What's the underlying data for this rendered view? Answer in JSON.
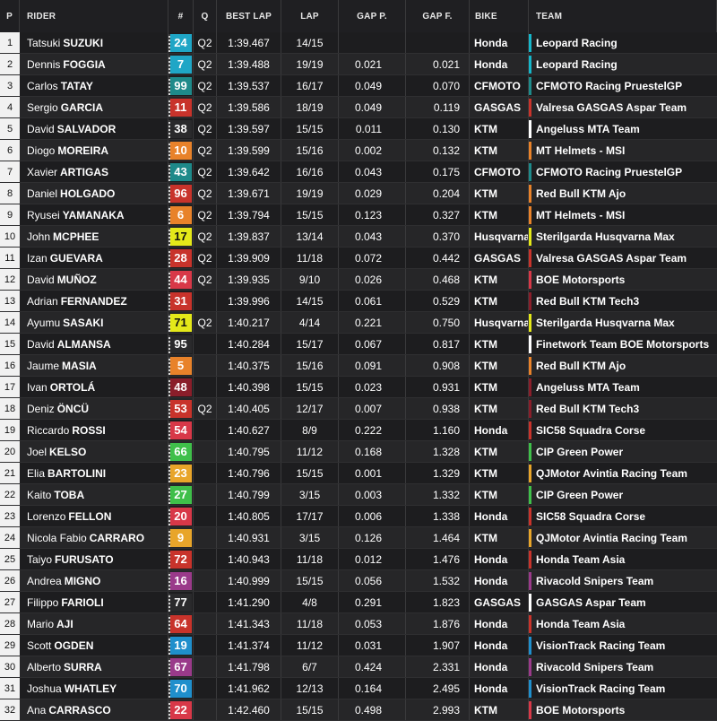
{
  "headers": {
    "pos": "P",
    "rider": "RIDER",
    "num": "#",
    "q": "Q",
    "best": "BEST LAP",
    "lap": "LAP",
    "gapp": "GAP P.",
    "gapf": "GAP F.",
    "bike": "BIKE",
    "team": "TEAM"
  },
  "rows": [
    {
      "pos": "1",
      "first": "Tatsuki",
      "last": "SUZUKI",
      "num": "24",
      "numColor": "#1fa6c6",
      "q": "Q2",
      "best": "1:39.467",
      "lap": "14/15",
      "gapp": "",
      "gapf": "",
      "bike": "Honda",
      "team": "Leopard Racing",
      "teamColor": "#16b6c9"
    },
    {
      "pos": "2",
      "first": "Dennis",
      "last": "FOGGIA",
      "num": "7",
      "numColor": "#1fa6c6",
      "q": "Q2",
      "best": "1:39.488",
      "lap": "19/19",
      "gapp": "0.021",
      "gapf": "0.021",
      "bike": "Honda",
      "team": "Leopard Racing",
      "teamColor": "#16b6c9"
    },
    {
      "pos": "3",
      "first": "Carlos",
      "last": "TATAY",
      "num": "99",
      "numColor": "#1e8a8a",
      "q": "Q2",
      "best": "1:39.537",
      "lap": "16/17",
      "gapp": "0.049",
      "gapf": "0.070",
      "bike": "CFMOTO",
      "team": "CFMOTO Racing PruestelGP",
      "teamColor": "#1e8a8a"
    },
    {
      "pos": "4",
      "first": "Sergio",
      "last": "GARCIA",
      "num": "11",
      "numColor": "#c8332b",
      "q": "Q2",
      "best": "1:39.586",
      "lap": "18/19",
      "gapp": "0.049",
      "gapf": "0.119",
      "bike": "GASGAS",
      "team": "Valresa GASGAS Aspar Team",
      "teamColor": "#c8332b"
    },
    {
      "pos": "5",
      "first": "David",
      "last": "SALVADOR",
      "num": "38",
      "numColor": "#2a2a2c",
      "q": "Q2",
      "best": "1:39.597",
      "lap": "15/15",
      "gapp": "0.011",
      "gapf": "0.130",
      "bike": "KTM",
      "team": "Angeluss MTA Team",
      "teamColor": "#ffffff"
    },
    {
      "pos": "6",
      "first": "Diogo",
      "last": "MOREIRA",
      "num": "10",
      "numColor": "#e8822a",
      "q": "Q2",
      "best": "1:39.599",
      "lap": "15/16",
      "gapp": "0.002",
      "gapf": "0.132",
      "bike": "KTM",
      "team": "MT Helmets - MSI",
      "teamColor": "#e8822a"
    },
    {
      "pos": "7",
      "first": "Xavier",
      "last": "ARTIGAS",
      "num": "43",
      "numColor": "#1e8a8a",
      "q": "Q2",
      "best": "1:39.642",
      "lap": "16/16",
      "gapp": "0.043",
      "gapf": "0.175",
      "bike": "CFMOTO",
      "team": "CFMOTO Racing PruestelGP",
      "teamColor": "#1e8a8a"
    },
    {
      "pos": "8",
      "first": "Daniel",
      "last": "HOLGADO",
      "num": "96",
      "numColor": "#c8332b",
      "q": "Q2",
      "best": "1:39.671",
      "lap": "19/19",
      "gapp": "0.029",
      "gapf": "0.204",
      "bike": "KTM",
      "team": "Red Bull KTM Ajo",
      "teamColor": "#e8822a"
    },
    {
      "pos": "9",
      "first": "Ryusei",
      "last": "YAMANAKA",
      "num": "6",
      "numColor": "#e8822a",
      "q": "Q2",
      "best": "1:39.794",
      "lap": "15/15",
      "gapp": "0.123",
      "gapf": "0.327",
      "bike": "KTM",
      "team": "MT Helmets - MSI",
      "teamColor": "#e8822a"
    },
    {
      "pos": "10",
      "first": "John",
      "last": "MCPHEE",
      "num": "17",
      "numColor": "#e4e819",
      "q": "Q2",
      "best": "1:39.837",
      "lap": "13/14",
      "gapp": "0.043",
      "gapf": "0.370",
      "bike": "Husqvarna",
      "team": "Sterilgarda Husqvarna Max",
      "teamColor": "#e4e819"
    },
    {
      "pos": "11",
      "first": "Izan",
      "last": "GUEVARA",
      "num": "28",
      "numColor": "#c8332b",
      "q": "Q2",
      "best": "1:39.909",
      "lap": "11/18",
      "gapp": "0.072",
      "gapf": "0.442",
      "bike": "GASGAS",
      "team": "Valresa GASGAS Aspar Team",
      "teamColor": "#c8332b"
    },
    {
      "pos": "12",
      "first": "David",
      "last": "MUÑOZ",
      "num": "44",
      "numColor": "#d83848",
      "q": "Q2",
      "best": "1:39.935",
      "lap": "9/10",
      "gapp": "0.026",
      "gapf": "0.468",
      "bike": "KTM",
      "team": "BOE Motorsports",
      "teamColor": "#d83848"
    },
    {
      "pos": "13",
      "first": "Adrian",
      "last": "FERNANDEZ",
      "num": "31",
      "numColor": "#c8332b",
      "q": "",
      "best": "1:39.996",
      "lap": "14/15",
      "gapp": "0.061",
      "gapf": "0.529",
      "bike": "KTM",
      "team": "Red Bull KTM Tech3",
      "teamColor": "#8a1e2a"
    },
    {
      "pos": "14",
      "first": "Ayumu",
      "last": "SASAKI",
      "num": "71",
      "numColor": "#e4e819",
      "q": "Q2",
      "best": "1:40.217",
      "lap": "4/14",
      "gapp": "0.221",
      "gapf": "0.750",
      "bike": "Husqvarna",
      "team": "Sterilgarda Husqvarna Max",
      "teamColor": "#e4e819"
    },
    {
      "pos": "15",
      "first": "David",
      "last": "ALMANSA",
      "num": "95",
      "numColor": "#2a2a2c",
      "q": "",
      "best": "1:40.284",
      "lap": "15/17",
      "gapp": "0.067",
      "gapf": "0.817",
      "bike": "KTM",
      "team": "Finetwork Team BOE Motorsports",
      "teamColor": "#ffffff"
    },
    {
      "pos": "16",
      "first": "Jaume",
      "last": "MASIA",
      "num": "5",
      "numColor": "#e8822a",
      "q": "",
      "best": "1:40.375",
      "lap": "15/16",
      "gapp": "0.091",
      "gapf": "0.908",
      "bike": "KTM",
      "team": "Red Bull KTM Ajo",
      "teamColor": "#e8822a"
    },
    {
      "pos": "17",
      "first": "Ivan",
      "last": "ORTOLÁ",
      "num": "48",
      "numColor": "#8a1e2a",
      "q": "",
      "best": "1:40.398",
      "lap": "15/15",
      "gapp": "0.023",
      "gapf": "0.931",
      "bike": "KTM",
      "team": "Angeluss MTA Team",
      "teamColor": "#8a1e2a"
    },
    {
      "pos": "18",
      "first": "Deniz",
      "last": "ÖNCÜ",
      "num": "53",
      "numColor": "#c8332b",
      "q": "Q2",
      "best": "1:40.405",
      "lap": "12/17",
      "gapp": "0.007",
      "gapf": "0.938",
      "bike": "KTM",
      "team": "Red Bull KTM Tech3",
      "teamColor": "#8a1e2a"
    },
    {
      "pos": "19",
      "first": "Riccardo",
      "last": "ROSSI",
      "num": "54",
      "numColor": "#d83848",
      "q": "",
      "best": "1:40.627",
      "lap": "8/9",
      "gapp": "0.222",
      "gapf": "1.160",
      "bike": "Honda",
      "team": "SIC58 Squadra Corse",
      "teamColor": "#c8332b"
    },
    {
      "pos": "20",
      "first": "Joel",
      "last": "KELSO",
      "num": "66",
      "numColor": "#3fbf4a",
      "q": "",
      "best": "1:40.795",
      "lap": "11/12",
      "gapp": "0.168",
      "gapf": "1.328",
      "bike": "KTM",
      "team": "CIP Green Power",
      "teamColor": "#3fbf4a"
    },
    {
      "pos": "21",
      "first": "Elia",
      "last": "BARTOLINI",
      "num": "23",
      "numColor": "#e8a52a",
      "q": "",
      "best": "1:40.796",
      "lap": "15/15",
      "gapp": "0.001",
      "gapf": "1.329",
      "bike": "KTM",
      "team": "QJMotor Avintia Racing Team",
      "teamColor": "#e8a52a"
    },
    {
      "pos": "22",
      "first": "Kaito",
      "last": "TOBA",
      "num": "27",
      "numColor": "#3fbf4a",
      "q": "",
      "best": "1:40.799",
      "lap": "3/15",
      "gapp": "0.003",
      "gapf": "1.332",
      "bike": "KTM",
      "team": "CIP Green Power",
      "teamColor": "#3fbf4a"
    },
    {
      "pos": "23",
      "first": "Lorenzo",
      "last": "FELLON",
      "num": "20",
      "numColor": "#d83848",
      "q": "",
      "best": "1:40.805",
      "lap": "17/17",
      "gapp": "0.006",
      "gapf": "1.338",
      "bike": "Honda",
      "team": "SIC58 Squadra Corse",
      "teamColor": "#c8332b"
    },
    {
      "pos": "24",
      "first": "Nicola Fabio",
      "last": "CARRARO",
      "num": "9",
      "numColor": "#e8a52a",
      "q": "",
      "best": "1:40.931",
      "lap": "3/15",
      "gapp": "0.126",
      "gapf": "1.464",
      "bike": "KTM",
      "team": "QJMotor Avintia Racing Team",
      "teamColor": "#e8a52a"
    },
    {
      "pos": "25",
      "first": "Taiyo",
      "last": "FURUSATO",
      "num": "72",
      "numColor": "#c8332b",
      "q": "",
      "best": "1:40.943",
      "lap": "11/18",
      "gapp": "0.012",
      "gapf": "1.476",
      "bike": "Honda",
      "team": "Honda Team Asia",
      "teamColor": "#c8332b"
    },
    {
      "pos": "26",
      "first": "Andrea",
      "last": "MIGNO",
      "num": "16",
      "numColor": "#9a3a8a",
      "q": "",
      "best": "1:40.999",
      "lap": "15/15",
      "gapp": "0.056",
      "gapf": "1.532",
      "bike": "Honda",
      "team": "Rivacold Snipers Team",
      "teamColor": "#9a3a8a"
    },
    {
      "pos": "27",
      "first": "Filippo",
      "last": "FARIOLI",
      "num": "77",
      "numColor": "#2a2a2c",
      "q": "",
      "best": "1:41.290",
      "lap": "4/8",
      "gapp": "0.291",
      "gapf": "1.823",
      "bike": "GASGAS",
      "team": "GASGAS Aspar Team",
      "teamColor": "#ffffff"
    },
    {
      "pos": "28",
      "first": "Mario",
      "last": "AJI",
      "num": "64",
      "numColor": "#c8332b",
      "q": "",
      "best": "1:41.343",
      "lap": "11/18",
      "gapp": "0.053",
      "gapf": "1.876",
      "bike": "Honda",
      "team": "Honda Team Asia",
      "teamColor": "#c8332b"
    },
    {
      "pos": "29",
      "first": "Scott",
      "last": "OGDEN",
      "num": "19",
      "numColor": "#1f8fcc",
      "q": "",
      "best": "1:41.374",
      "lap": "11/12",
      "gapp": "0.031",
      "gapf": "1.907",
      "bike": "Honda",
      "team": "VisionTrack Racing Team",
      "teamColor": "#1f8fcc"
    },
    {
      "pos": "30",
      "first": "Alberto",
      "last": "SURRA",
      "num": "67",
      "numColor": "#9a3a8a",
      "q": "",
      "best": "1:41.798",
      "lap": "6/7",
      "gapp": "0.424",
      "gapf": "2.331",
      "bike": "Honda",
      "team": "Rivacold Snipers Team",
      "teamColor": "#9a3a8a"
    },
    {
      "pos": "31",
      "first": "Joshua",
      "last": "WHATLEY",
      "num": "70",
      "numColor": "#1f8fcc",
      "q": "",
      "best": "1:41.962",
      "lap": "12/13",
      "gapp": "0.164",
      "gapf": "2.495",
      "bike": "Honda",
      "team": "VisionTrack Racing Team",
      "teamColor": "#1f8fcc"
    },
    {
      "pos": "32",
      "first": "Ana",
      "last": "CARRASCO",
      "num": "22",
      "numColor": "#d83848",
      "q": "",
      "best": "1:42.460",
      "lap": "15/15",
      "gapp": "0.498",
      "gapf": "2.993",
      "bike": "KTM",
      "team": "BOE Motorsports",
      "teamColor": "#d83848"
    }
  ]
}
